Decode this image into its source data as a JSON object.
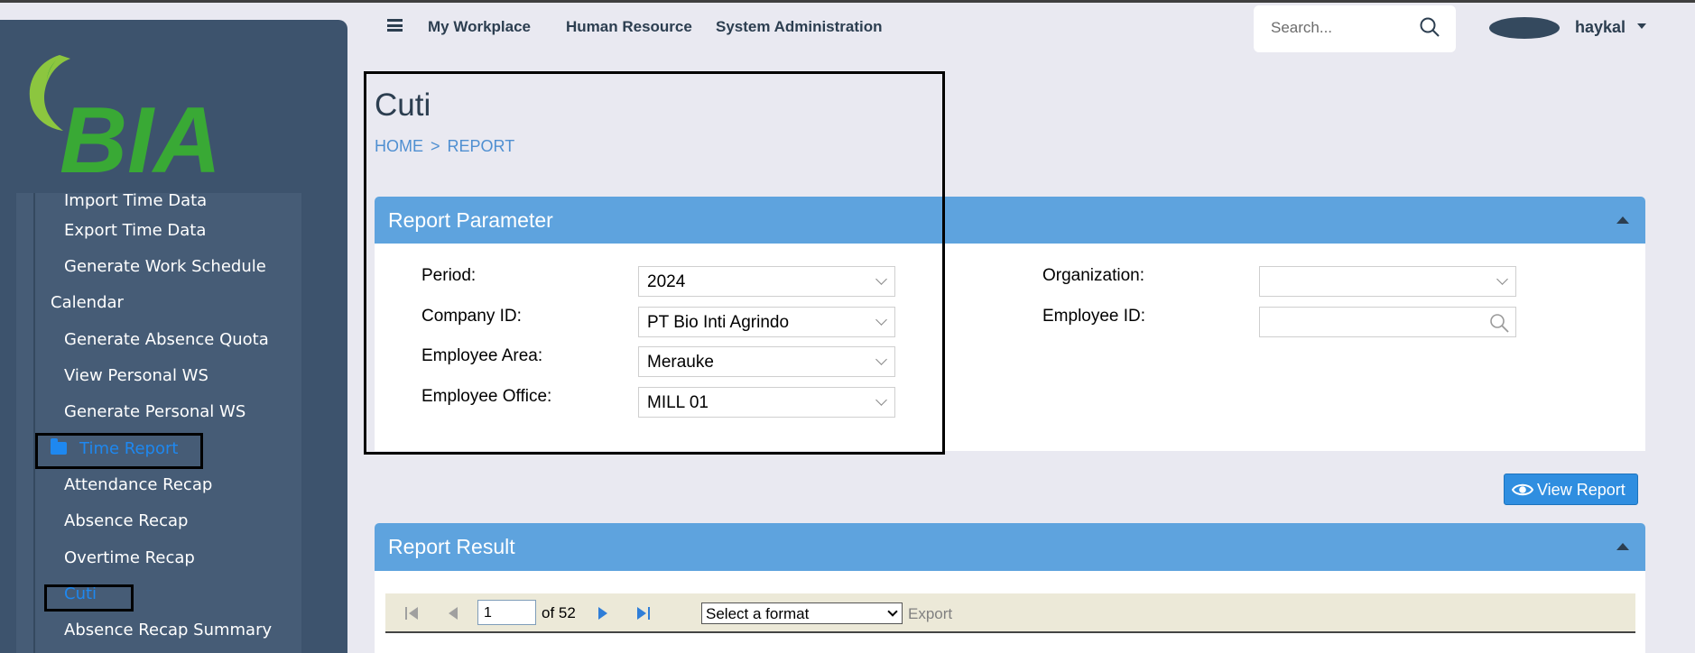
{
  "app": {
    "logo_text": "BIA",
    "user_name": "haykal",
    "search_placeholder": "Search..."
  },
  "nav": {
    "items": [
      "My Workplace",
      "Human Resource",
      "System Administration"
    ]
  },
  "sidebar": {
    "items": [
      {
        "label": "Import Time Data"
      },
      {
        "label": "Export Time Data"
      },
      {
        "label": "Generate Work Schedule"
      },
      {
        "label": "Calendar"
      },
      {
        "label": "Generate Absence Quota"
      },
      {
        "label": "View Personal WS"
      },
      {
        "label": "Generate Personal WS"
      },
      {
        "label": "Time Report"
      },
      {
        "label": "Attendance Recap"
      },
      {
        "label": "Absence Recap"
      },
      {
        "label": "Overtime Recap"
      },
      {
        "label": "Cuti"
      },
      {
        "label": "Absence Recap Summary"
      }
    ]
  },
  "page": {
    "title": "Cuti",
    "breadcrumb": [
      "HOME",
      ">",
      "REPORT"
    ]
  },
  "report_parameter": {
    "title": "Report Parameter",
    "fields": {
      "period": {
        "label": "Period:",
        "value": "2024"
      },
      "company_id": {
        "label": "Company ID:",
        "value": "PT Bio Inti Agrindo"
      },
      "employee_area": {
        "label": "Employee Area:",
        "value": "Merauke"
      },
      "employee_office": {
        "label": "Employee Office:",
        "value": "MILL 01"
      },
      "organization": {
        "label": "Organization:",
        "value": ""
      },
      "employee_id": {
        "label": "Employee ID:",
        "value": ""
      }
    },
    "view_button": "View Report"
  },
  "report_result": {
    "title": "Report Result",
    "toolbar": {
      "page_value": "1",
      "of_text": "of 52",
      "format_placeholder": "Select a format",
      "export_label": "Export"
    }
  },
  "colors": {
    "sidebar": "#3d536d",
    "panel_header": "#5ea3de",
    "accent": "#1e88f0",
    "button": "#2f8ee0"
  }
}
